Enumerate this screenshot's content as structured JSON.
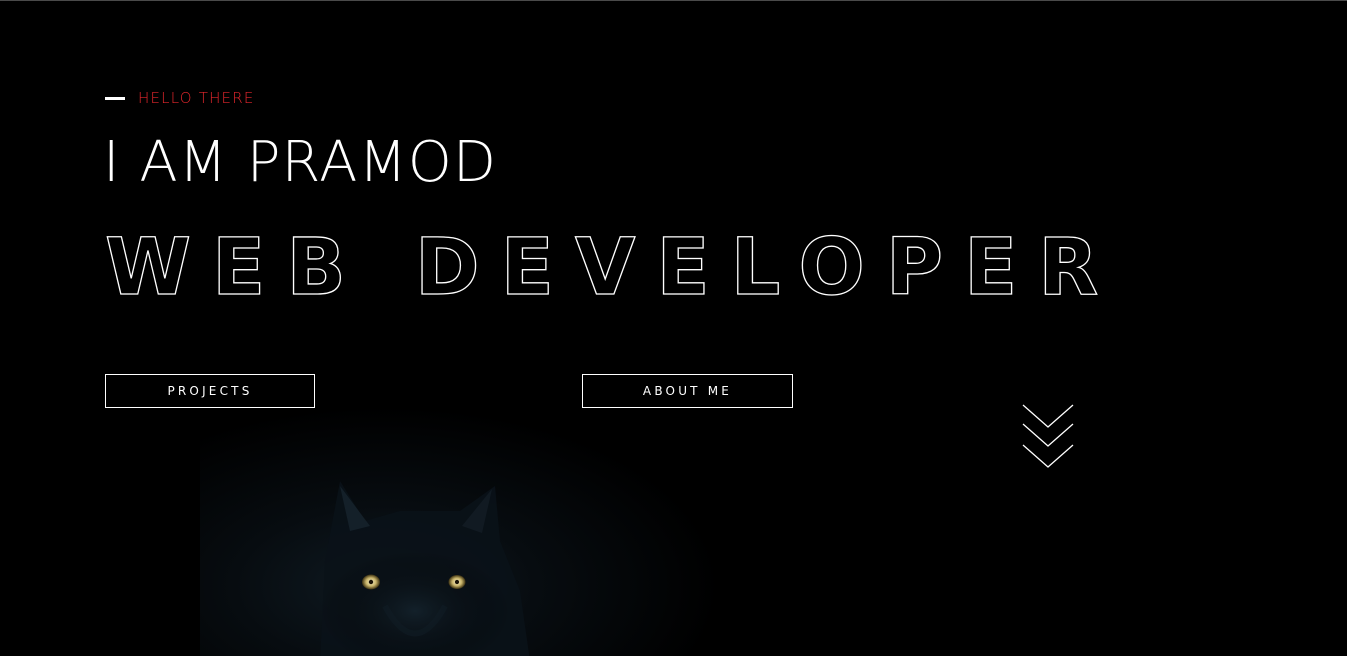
{
  "hero": {
    "greeting": "HELLO THERE",
    "name_line": "I AM PRAMOD",
    "role": "WEB DEVELOPER"
  },
  "buttons": {
    "projects_label": "PROJECTS",
    "about_label": "ABOUT ME"
  },
  "icons": {
    "scroll": "chevron-triple-down-icon",
    "background": "wolf-image"
  },
  "colors": {
    "background": "#000000",
    "accent": "#e3262c",
    "text": "#ffffff"
  }
}
